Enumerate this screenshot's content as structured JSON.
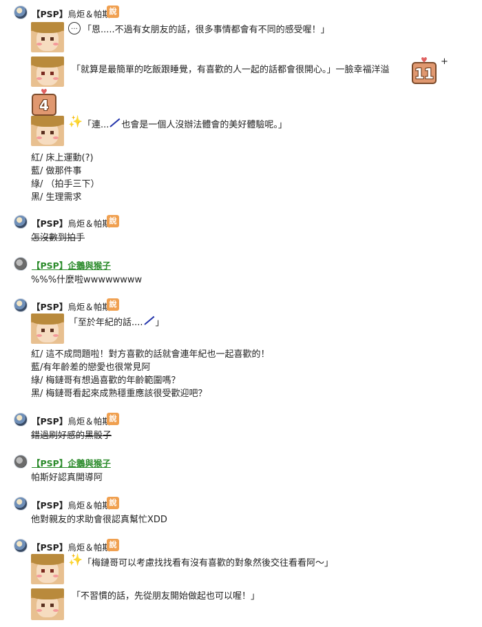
{
  "users": {
    "main": {
      "name_bold": "【PSP】",
      "name_rest": "烏炬＆帕斯",
      "badge": "說"
    },
    "other": {
      "name_bold": "【PSP】",
      "name_rest": "企鵝與猴子"
    }
  },
  "posts": [
    {
      "lines": [
        "「恩.....不過有女朋友的話，很多事情都會有不同的感受喔！」",
        "「就算是最簡單的吃飯跟睡覺，有喜歡的人一起的話都會很開心。」一臉幸福洋溢",
        "+",
        "「連...",
        "也會是一個人沒辦法體會的美好體驗呢。」",
        "紅/ 床上運動(?)",
        "藍/ 做那件事",
        "綠/ （拍手三下）",
        "黑/ 生理需求"
      ],
      "stickers": [
        "11",
        "4"
      ]
    },
    {
      "lines": [
        "怎沒數到拍手"
      ]
    },
    {
      "lines": [
        "%%%什麼啦wwwwwwww"
      ]
    },
    {
      "lines": [
        "「至於年紀的話....",
        "」",
        "紅/ 這不成問題啦！對方喜歡的話就會連年紀也一起喜歡的！",
        "藍/有年齡差的戀愛也很常見阿",
        "綠/ 梅鏈哥有想過喜歡的年齡範圍嗎？",
        "黑/ 梅鏈哥看起來成熟穩重應該很受歡迎吧？"
      ]
    },
    {
      "lines": [
        "錯過刷好感的黑骰子"
      ]
    },
    {
      "lines": [
        "帕斯好認真開導阿"
      ]
    },
    {
      "lines": [
        "他對親友的求助會很認真幫忙XDD"
      ]
    },
    {
      "lines": [
        "「梅鏈哥可以考慮找找看有沒有喜歡的對象然後交往看看阿～」",
        "「不習慣的話，先從朋友開始做起也可以喔！」"
      ]
    }
  ],
  "colors": {
    "badge": "#f0a050",
    "link_green": "#2a8a2a"
  }
}
